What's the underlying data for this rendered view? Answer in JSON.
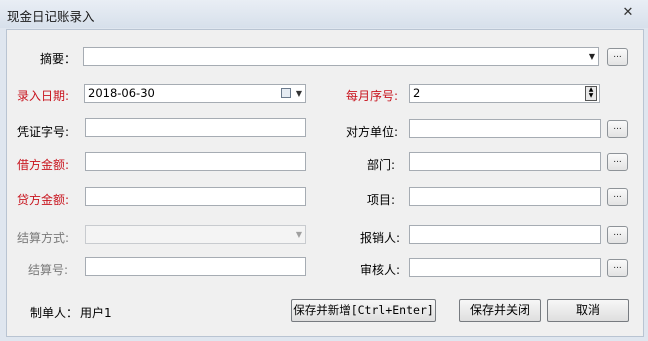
{
  "window": {
    "title": "现金日记账录入",
    "close_glyph": "✕"
  },
  "form": {
    "summary": {
      "label": "摘要：",
      "value": ""
    },
    "entry_date": {
      "label": "录入日期:",
      "value": "2018-06-30"
    },
    "monthly_seq": {
      "label": "每月序号:",
      "value": "2"
    },
    "voucher_no": {
      "label": "凭证字号:",
      "value": ""
    },
    "counterparty": {
      "label": "对方单位:",
      "value": ""
    },
    "debit_amount": {
      "label": "借方金额:",
      "value": ""
    },
    "department": {
      "label": "部门:",
      "value": ""
    },
    "credit_amount": {
      "label": "贷方金额:",
      "value": ""
    },
    "project": {
      "label": "项目:",
      "value": ""
    },
    "settlement_method": {
      "label": "结算方式:",
      "value": ""
    },
    "reimburser": {
      "label": "报销人:",
      "value": ""
    },
    "settlement_no": {
      "label": "结算号:",
      "value": ""
    },
    "reviewer": {
      "label": "审核人:",
      "value": ""
    }
  },
  "footer": {
    "creator_label": "制单人：",
    "creator_value": "用户1",
    "save_new_label": "保存并新增[Ctrl+Enter]",
    "save_close_label": "保存并关闭",
    "cancel_label": "取消"
  },
  "browse_label": "...",
  "colors": {
    "required_label": "#c8141e",
    "disabled_label": "#7a7a7a"
  }
}
